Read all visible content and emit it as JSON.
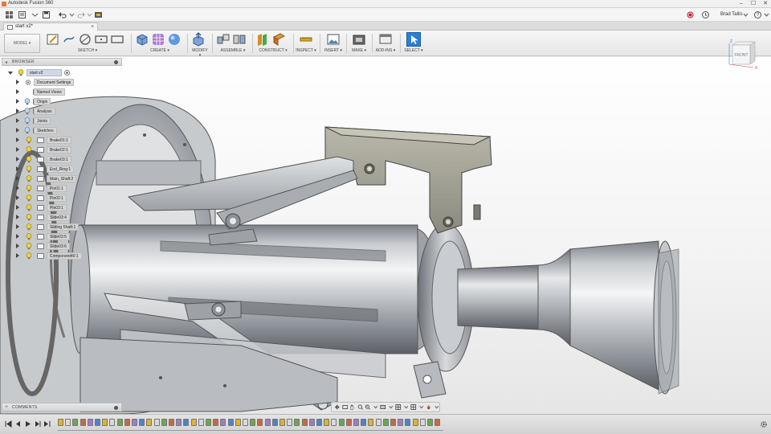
{
  "app": {
    "title": "Autodesk Fusion 360",
    "window_controls": [
      "–",
      "☐",
      "✕"
    ]
  },
  "qabar": {
    "user_name": "Brad Tallis",
    "help_label": "?"
  },
  "document_tab": {
    "name": "start v2*",
    "close": "×"
  },
  "toolbar": {
    "workspace": "MODEL",
    "groups": [
      {
        "label": "SKETCH ▾",
        "icons": [
          "sketch-icon",
          "line-icon",
          "circle-icon",
          "rectangle-icon",
          "slot-icon"
        ]
      },
      {
        "label": "CREATE ▾",
        "icons": [
          "box-icon",
          "form-icon",
          "sphere-icon"
        ]
      },
      {
        "label": "MODIFY ▾",
        "icons": [
          "press-pull-icon"
        ]
      },
      {
        "label": "ASSEMBLE ▾",
        "icons": [
          "new-component-icon",
          "joint-icon"
        ]
      },
      {
        "label": "CONSTRUCT ▾",
        "icons": [
          "offset-plane-icon",
          "midplane-icon"
        ]
      },
      {
        "label": "INSPECT ▾",
        "icons": [
          "measure-icon"
        ]
      },
      {
        "label": "INSERT ▾",
        "icons": [
          "insert-image-icon"
        ]
      },
      {
        "label": "MAKE ▾",
        "icons": [
          "3d-print-icon"
        ]
      },
      {
        "label": "ADD-INS ▾",
        "icons": [
          "scripts-icon"
        ]
      },
      {
        "label": "SELECT ▾",
        "icons": [
          "select-icon"
        ]
      }
    ]
  },
  "viewcube": {
    "face_label": "FRONT",
    "axis_z": "Z",
    "axis_x": "X"
  },
  "browser": {
    "title": "BROWSER",
    "root": "start v2",
    "items": [
      {
        "label": "Document Settings",
        "icon": "gear"
      },
      {
        "label": "Named Views",
        "icon": "folder"
      },
      {
        "label": "Origin",
        "icon": "folder"
      },
      {
        "label": "Analysis",
        "icon": "folder"
      },
      {
        "label": "Joints",
        "icon": "folder"
      },
      {
        "label": "Sketches",
        "icon": "folder"
      },
      {
        "label": "Brake01:1",
        "icon": "component"
      },
      {
        "label": "Brake02:1",
        "icon": "component"
      },
      {
        "label": "Brake03:1",
        "icon": "component"
      },
      {
        "label": "End_Ring:1",
        "icon": "component"
      },
      {
        "label": "Main_Shaft:2",
        "icon": "component"
      },
      {
        "label": "Pin01:1",
        "icon": "component"
      },
      {
        "label": "Pin02:1",
        "icon": "component"
      },
      {
        "label": "Pin03:1",
        "icon": "component"
      },
      {
        "label": "Slide03:4",
        "icon": "component"
      },
      {
        "label": "Sliding Shaft:1",
        "icon": "component"
      },
      {
        "label": "Slide03:5",
        "icon": "component"
      },
      {
        "label": "Slide03:6",
        "icon": "component"
      },
      {
        "label": "Component40:1",
        "icon": "component"
      }
    ]
  },
  "comments": {
    "title": "COMMENTS",
    "add": "+"
  },
  "colors": {
    "accent_blue": "#2a7fd4",
    "metal_light": "#e4e6e8",
    "metal_dark": "#8b9096",
    "bracket": "#9b9a8d"
  }
}
